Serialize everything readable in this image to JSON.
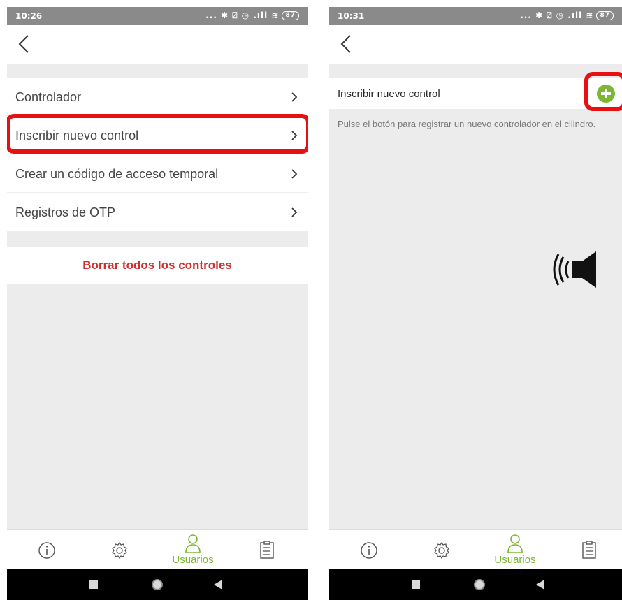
{
  "left": {
    "status_time": "10:26",
    "status_icons": "... ✱ ⍁ ◷ .ıll ≋",
    "battery": "87",
    "menu": [
      {
        "label": "Controlador"
      },
      {
        "label": "Inscribir nuevo control"
      },
      {
        "label": "Crear un código de acceso temporal"
      },
      {
        "label": "Registros de OTP"
      }
    ],
    "delete_label": "Borrar todos los controles",
    "nav_active_label": "Usuarios"
  },
  "right": {
    "status_time": "10:31",
    "status_icons": "... ✱ ⍁ ◷ .ıll ≋",
    "battery": "87",
    "title": "Inscribir nuevo control",
    "hint": "Pulse el botón para registrar un nuevo controlador en el cilindro.",
    "nav_active_label": "Usuarios"
  },
  "colors": {
    "accent": "#7cb733",
    "danger": "#d32f2f",
    "highlight": "#e81010"
  },
  "icons": [
    "back-chevron-icon",
    "chevron-right-icon",
    "info-icon",
    "gear-icon",
    "user-icon",
    "clipboard-icon",
    "plus-icon",
    "speaker-icon",
    "square-icon",
    "circle-icon",
    "triangle-back-icon"
  ]
}
